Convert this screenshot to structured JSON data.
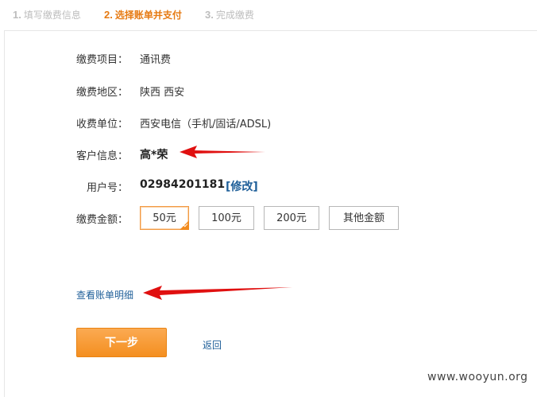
{
  "steps": [
    {
      "num": "1.",
      "label": "填写缴费信息"
    },
    {
      "num": "2.",
      "label": "选择账单并支付"
    },
    {
      "num": "3.",
      "label": "完成缴费"
    }
  ],
  "form": {
    "item_label": "缴费项目：",
    "item_value": "通讯费",
    "region_label": "缴费地区：",
    "region_value": "陕西 西安",
    "unit_label": "收费单位：",
    "unit_value": "西安电信（手机/固话/ADSL)",
    "customer_label": "客户信息：",
    "customer_value": "高*荣",
    "account_label": "用户号：",
    "account_value": "02984201181",
    "modify_link": "[修改]",
    "amount_label": "缴费金额：",
    "amounts": [
      "50元",
      "100元",
      "200元",
      "其他金额"
    ],
    "selected_amount": "50元"
  },
  "bill_detail_link": "查看账单明细",
  "next_button": "下一步",
  "back_link": "返回",
  "watermark": "www.wooyun.org",
  "colors": {
    "accent": "#f48f20",
    "link": "#1f5f99",
    "annotation_arrow": "#e01010"
  }
}
